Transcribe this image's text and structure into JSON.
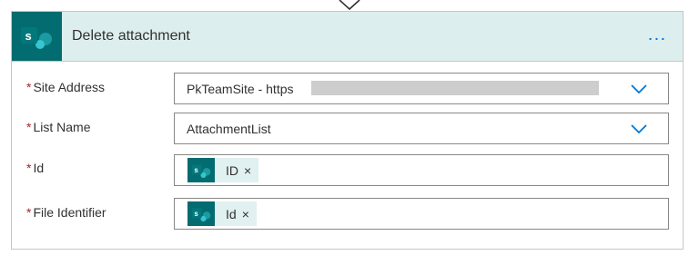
{
  "action": {
    "title": "Delete attachment",
    "more_label": "...",
    "icon": "sharepoint-icon",
    "icon_letter": "s"
  },
  "fields": [
    {
      "label": "Site Address",
      "required": "*",
      "value": "PkTeamSite - https",
      "control": "dropdown"
    },
    {
      "label": "List Name",
      "required": "*",
      "value": "AttachmentList",
      "control": "dropdown"
    },
    {
      "label": "Id",
      "required": "*",
      "token": {
        "label": "ID",
        "remove": "×",
        "icon": "sharepoint-icon"
      }
    },
    {
      "label": "File Identifier",
      "required": "*",
      "token": {
        "label": "Id",
        "remove": "×",
        "icon": "sharepoint-icon"
      }
    }
  ],
  "colors": {
    "accent": "#0078d4",
    "sharepoint": "#036c70",
    "header_bg": "#ddeeee",
    "required": "#a4262c"
  }
}
